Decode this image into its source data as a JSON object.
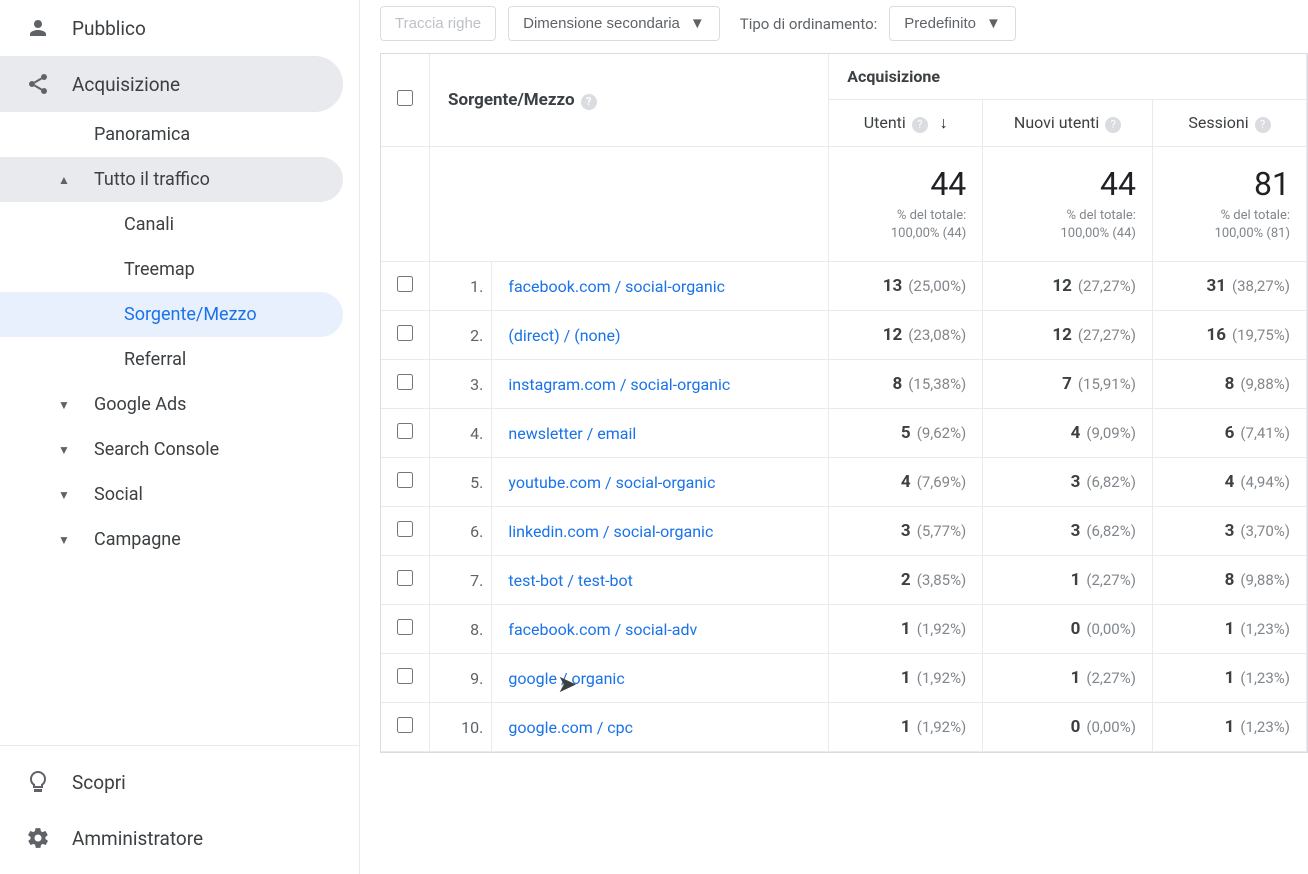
{
  "sidebar": {
    "pubblico": "Pubblico",
    "acquisizione": "Acquisizione",
    "panoramica": "Panoramica",
    "tutto_traffico": "Tutto il traffico",
    "canali": "Canali",
    "treemap": "Treemap",
    "sorgente_mezzo": "Sorgente/Mezzo",
    "referral": "Referral",
    "google_ads": "Google Ads",
    "search_console": "Search Console",
    "social": "Social",
    "campagne": "Campagne",
    "scopri": "Scopri",
    "amministratore": "Amministratore"
  },
  "toolbar": {
    "traccia_righe": "Traccia righe",
    "dim_secondaria": "Dimensione secondaria",
    "sort_label": "Tipo di ordinamento:",
    "predefinito": "Predefinito"
  },
  "table": {
    "header": {
      "sorgente_mezzo": "Sorgente/Mezzo",
      "acquisizione": "Acquisizione",
      "utenti": "Utenti",
      "nuovi_utenti": "Nuovi utenti",
      "sessioni": "Sessioni"
    },
    "totals": {
      "utenti": {
        "value": "44",
        "subtitle_label": "% del totale:",
        "subtitle_value": "100,00% (44)"
      },
      "nuovi": {
        "value": "44",
        "subtitle_label": "% del totale:",
        "subtitle_value": "100,00% (44)"
      },
      "sessioni": {
        "value": "81",
        "subtitle_label": "% del totale:",
        "subtitle_value": "100,00% (81)"
      }
    },
    "rows": [
      {
        "idx": "1.",
        "name": "facebook.com / social-organic",
        "utenti": "13",
        "utenti_pct": "(25,00%)",
        "nuovi": "12",
        "nuovi_pct": "(27,27%)",
        "sess": "31",
        "sess_pct": "(38,27%)"
      },
      {
        "idx": "2.",
        "name": "(direct) / (none)",
        "utenti": "12",
        "utenti_pct": "(23,08%)",
        "nuovi": "12",
        "nuovi_pct": "(27,27%)",
        "sess": "16",
        "sess_pct": "(19,75%)"
      },
      {
        "idx": "3.",
        "name": "instagram.com / social-organic",
        "utenti": "8",
        "utenti_pct": "(15,38%)",
        "nuovi": "7",
        "nuovi_pct": "(15,91%)",
        "sess": "8",
        "sess_pct": "(9,88%)"
      },
      {
        "idx": "4.",
        "name": "newsletter / email",
        "utenti": "5",
        "utenti_pct": "(9,62%)",
        "nuovi": "4",
        "nuovi_pct": "(9,09%)",
        "sess": "6",
        "sess_pct": "(7,41%)"
      },
      {
        "idx": "5.",
        "name": "youtube.com / social-organic",
        "utenti": "4",
        "utenti_pct": "(7,69%)",
        "nuovi": "3",
        "nuovi_pct": "(6,82%)",
        "sess": "4",
        "sess_pct": "(4,94%)"
      },
      {
        "idx": "6.",
        "name": "linkedin.com / social-organic",
        "utenti": "3",
        "utenti_pct": "(5,77%)",
        "nuovi": "3",
        "nuovi_pct": "(6,82%)",
        "sess": "3",
        "sess_pct": "(3,70%)"
      },
      {
        "idx": "7.",
        "name": "test-bot / test-bot",
        "utenti": "2",
        "utenti_pct": "(3,85%)",
        "nuovi": "1",
        "nuovi_pct": "(2,27%)",
        "sess": "8",
        "sess_pct": "(9,88%)"
      },
      {
        "idx": "8.",
        "name": "facebook.com / social-adv",
        "utenti": "1",
        "utenti_pct": "(1,92%)",
        "nuovi": "0",
        "nuovi_pct": "(0,00%)",
        "sess": "1",
        "sess_pct": "(1,23%)"
      },
      {
        "idx": "9.",
        "name": "google / organic",
        "utenti": "1",
        "utenti_pct": "(1,92%)",
        "nuovi": "1",
        "nuovi_pct": "(2,27%)",
        "sess": "1",
        "sess_pct": "(1,23%)"
      },
      {
        "idx": "10.",
        "name": "google.com / cpc",
        "utenti": "1",
        "utenti_pct": "(1,92%)",
        "nuovi": "0",
        "nuovi_pct": "(0,00%)",
        "sess": "1",
        "sess_pct": "(1,23%)"
      }
    ]
  }
}
